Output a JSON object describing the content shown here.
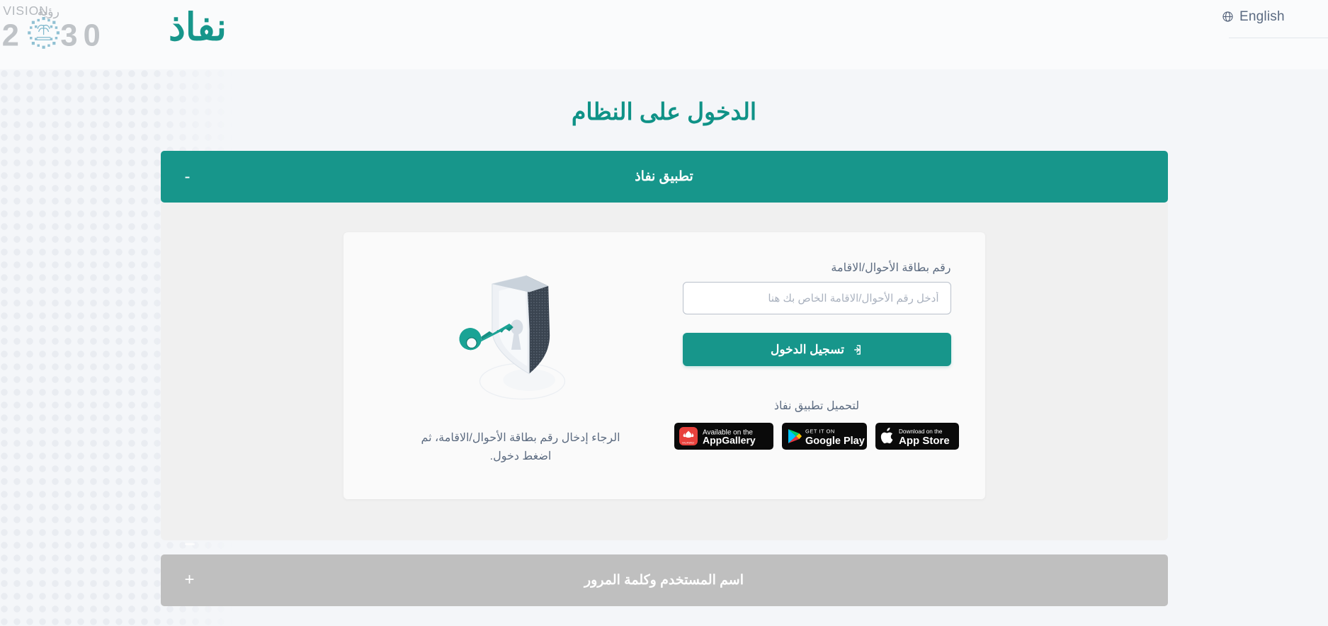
{
  "header": {
    "language_button": {
      "label": "English",
      "icon": "globe-icon"
    },
    "logos": {
      "vision_2030": {
        "name": "vision-2030-logo",
        "latin_text": "VISION",
        "arabic_text": "رؤية",
        "year": "2030"
      },
      "nafath": {
        "name": "nafath-logo",
        "text": "نفاذ",
        "color": "#17968b"
      }
    }
  },
  "main": {
    "page_title": "الدخول على النظام",
    "accordions": [
      {
        "id": "nafath-app",
        "title": "تطبيق نفاذ",
        "toggle": "-",
        "state": "expanded",
        "color": "#17968b"
      },
      {
        "id": "username-password",
        "title": "اسم المستخدم وكلمة المرور",
        "toggle": "+",
        "state": "collapsed",
        "color": "#bfbfbf"
      }
    ],
    "login_form": {
      "id_label": "رقم بطاقة الأحوال/الاقامة",
      "id_placeholder": "أدخل رقم الأحوال/الاقامة الخاص بك هنا",
      "id_value": "",
      "submit_label": "تسجيل الدخول",
      "submit_icon": "login-arrow-icon",
      "download_title": "لتحميل تطبيق نفاذ",
      "store_badges": [
        {
          "name": "appgallery-badge",
          "top_text": "Available on the",
          "main_text": "AppGallery",
          "icon": "huawei-appgallery-icon"
        },
        {
          "name": "google-play-badge",
          "top_text": "GET IT ON",
          "main_text": "Google Play",
          "icon": "google-play-icon"
        },
        {
          "name": "app-store-badge",
          "top_text": "Download on the",
          "main_text": "App Store",
          "icon": "apple-icon"
        }
      ]
    },
    "illustration": {
      "name": "shield-key-illustration",
      "hint_text": "الرجاء إدخال رقم بطاقة الأحوال/الاقامة، ثم اضغط دخول."
    }
  },
  "colors": {
    "accent_teal": "#17968b",
    "title_teal": "#0f9287",
    "gray_panel": "#bfbfbf",
    "page_bg": "#f4f6f9",
    "card_bg": "#fafafa"
  }
}
